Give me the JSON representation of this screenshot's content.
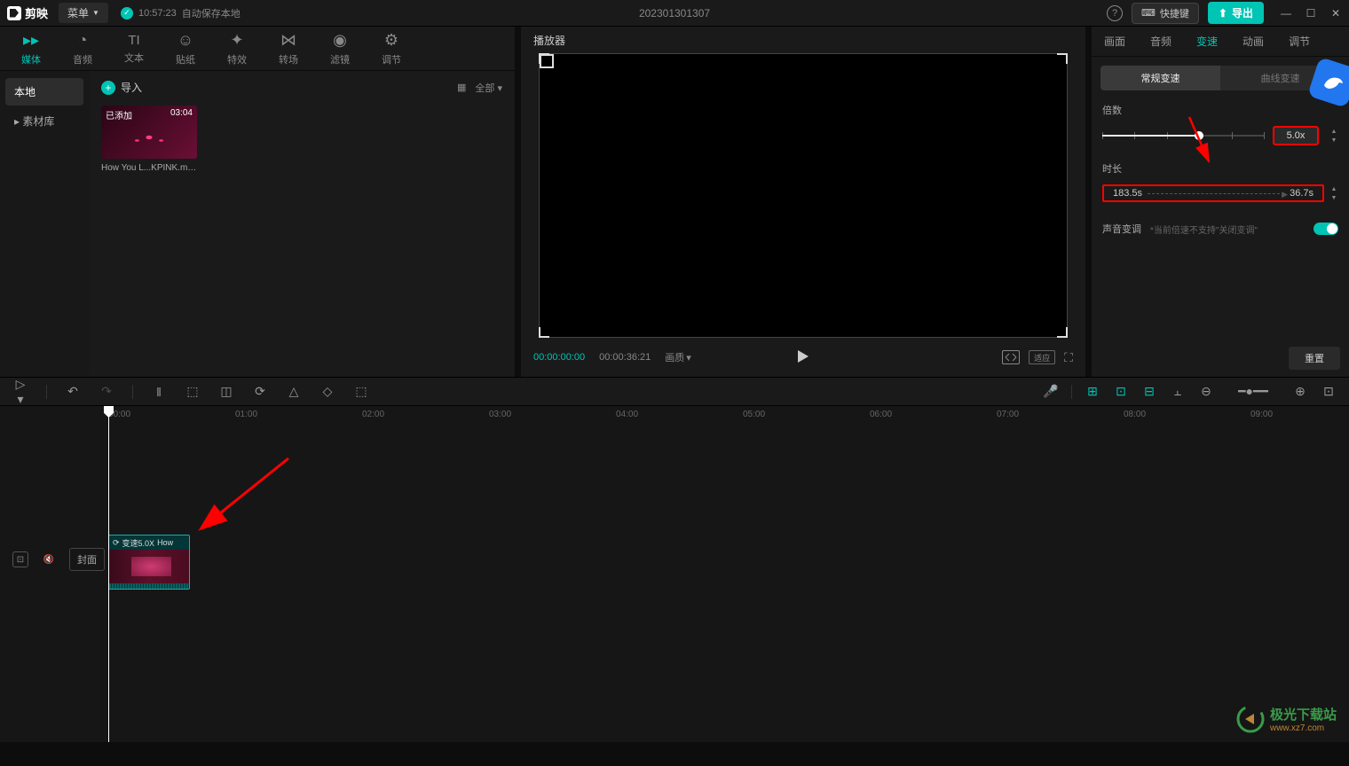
{
  "topbar": {
    "app_name": "剪映",
    "menu_label": "菜单",
    "save_time": "10:57:23",
    "save_text": "自动保存本地",
    "project_title": "202301301307",
    "shortcut_label": "快捷键",
    "export_label": "导出"
  },
  "asset_tabs": [
    {
      "label": "媒体",
      "icon": "▸"
    },
    {
      "label": "音频",
      "icon": "◔"
    },
    {
      "label": "文本",
      "icon": "TI"
    },
    {
      "label": "贴纸",
      "icon": "☺"
    },
    {
      "label": "特效",
      "icon": "✦"
    },
    {
      "label": "转场",
      "icon": "⋈"
    },
    {
      "label": "滤镜",
      "icon": "◯"
    },
    {
      "label": "调节",
      "icon": "⚙"
    }
  ],
  "asset_sidebar": [
    {
      "label": "本地",
      "active": true
    },
    {
      "label": "▸ 素材库",
      "active": false
    }
  ],
  "import_label": "导入",
  "sort_label": "全部",
  "media": {
    "added_label": "已添加",
    "duration": "03:04",
    "name": "How You L...KPINK.mp4"
  },
  "player": {
    "header": "播放器",
    "current_time": "00:00:00:00",
    "total_time": "00:00:36:21",
    "quality_label": "画质",
    "fit_label": "适应"
  },
  "prop_tabs": [
    "画面",
    "音频",
    "变速",
    "动画",
    "调节"
  ],
  "sub_tabs": [
    "常规变速",
    "曲线变速"
  ],
  "speed": {
    "label": "倍数",
    "value": "5.0x"
  },
  "duration": {
    "label": "时长",
    "from": "183.5s",
    "to": "36.7s"
  },
  "pitch": {
    "label": "声音变调",
    "hint": "*当前倍速不支持\"关闭变调\""
  },
  "reset_label": "重置",
  "timeline": {
    "cover_label": "封面",
    "marks": [
      "00:00",
      "01:00",
      "02:00",
      "03:00",
      "04:00",
      "05:00",
      "06:00",
      "07:00",
      "08:00",
      "09:00"
    ],
    "clip_label": "变速5.0X",
    "clip_name": "How"
  },
  "watermark": {
    "text": "极光下载站",
    "url": "www.xz7.com"
  }
}
